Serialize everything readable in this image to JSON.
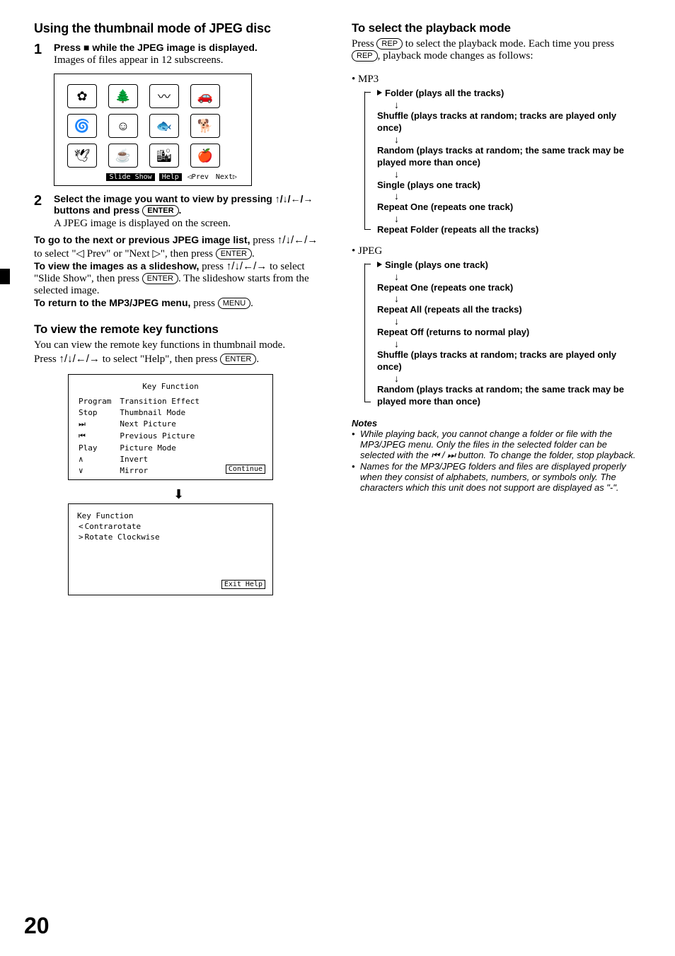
{
  "left": {
    "heading": "Using the thumbnail mode of JPEG disc",
    "step1": {
      "line1": "Press ■ while the JPEG image is displayed.",
      "line2": "Images of files appear in 12 subscreens."
    },
    "thumb_buttons": {
      "slideshow": "Slide Show",
      "help": "Help",
      "prev": "◁Prev",
      "next": "Next▷"
    },
    "step2": {
      "line1a": "Select the image you want to view by pressing ",
      "line1b": " buttons and press ",
      "enter": "ENTER",
      "line2": "A JPEG image is displayed on the screen."
    },
    "goto": {
      "h": "To go to the next or previous JPEG image list,",
      "t1": " press ",
      "t2": " to select \"◁ Prev\" or \"Next ▷\", then press ",
      "enter": "ENTER"
    },
    "slideshow": {
      "h": "To view the images as a slideshow,",
      "t1": " press ",
      "t2": " to select \"Slide Show\", then press ",
      "t3": ". The slideshow starts from the selected image.",
      "enter": "ENTER"
    },
    "ret": {
      "h": "To return to the MP3/JPEG menu,",
      "t": " press ",
      "menu": "MENU"
    },
    "remote_h": "To view the remote key functions",
    "remote_p1": "You can view the remote key functions in thumbnail mode.",
    "remote_p2a": "Press ",
    "remote_p2b": " to select \"Help\", then press ",
    "enter": "ENTER",
    "kf_title": "Key Function",
    "kf_rows": [
      [
        "Program",
        "Transition Effect"
      ],
      [
        "Stop",
        "Thumbnail Mode"
      ],
      [
        "⏭",
        "Next Picture"
      ],
      [
        "⏮",
        "Previous Picture"
      ],
      [
        "Play",
        "Picture Mode"
      ],
      [
        "∧",
        "Invert"
      ],
      [
        "∨",
        "Mirror"
      ]
    ],
    "kf_continue": "Continue",
    "kf2_rows": [
      [
        "<",
        "Contrarotate"
      ],
      [
        ">",
        "Rotate Clockwise"
      ]
    ],
    "kf_exit": "Exit Help"
  },
  "right": {
    "heading": "To select the playback mode",
    "p1a": "Press ",
    "rep": "REP",
    "p1b": " to select the playback mode. Each time you press ",
    "p1c": ", playback mode changes as follows:",
    "mp3_label": "• MP3",
    "mp3_flow": [
      "Folder (plays all the tracks)",
      "Shuffle (plays tracks at random; tracks are played only once)",
      "Random (plays tracks at random; the same track may be played more than once)",
      "Single (plays one track)",
      "Repeat One (repeats one track)",
      "Repeat Folder (repeats all the tracks)"
    ],
    "jpeg_label": "• JPEG",
    "jpeg_flow": [
      "Single (plays one track)",
      "Repeat One (repeats one track)",
      "Repeat All (repeats all the tracks)",
      "Repeat Off (returns to normal play)",
      "Shuffle (plays tracks at random; tracks are played only once)",
      "Random (plays tracks at random; the same track may be played more than once)"
    ],
    "notes_h": "Notes",
    "note1": "While playing back, you cannot change a folder or file with the MP3/JPEG menu. Only the files in the selected folder can be selected with the ⏮ / ⏭ button. To change the folder, stop playback.",
    "note2": "Names for the MP3/JPEG folders and files are displayed properly when they consist of alphabets, numbers, or symbols only. The characters which this unit does not support are displayed as \"-\"."
  },
  "arrows": "↑/↓/←/→",
  "page": "20"
}
